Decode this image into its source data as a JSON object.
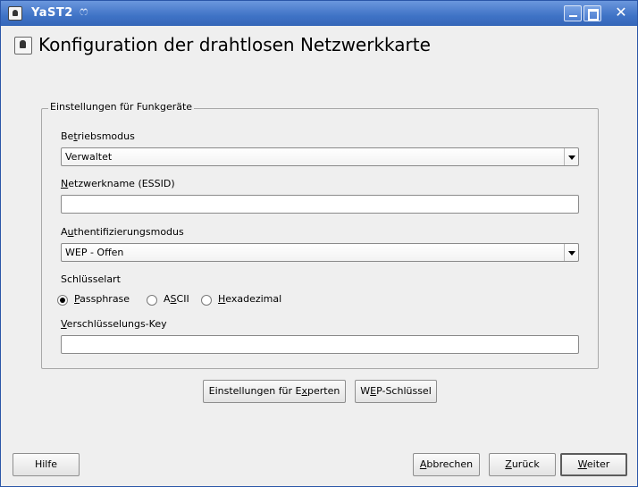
{
  "window": {
    "title": "YaST2",
    "swirl_glyph": "ෆ"
  },
  "page": {
    "title": "Konfiguration der drahtlosen Netzwerkkarte"
  },
  "group": {
    "title": "Einstellungen für Funkgeräte",
    "operating_mode": {
      "label_pre": "Be",
      "label_key": "t",
      "label_post": "riebsmodus",
      "value": "Verwaltet"
    },
    "network_name": {
      "label_pre": "",
      "label_key": "N",
      "label_post": "etzwerkname (ESSID)",
      "value": ""
    },
    "auth_mode": {
      "label_pre": "A",
      "label_key": "u",
      "label_post": "thentifizierungsmodus",
      "value": "WEP - Offen"
    },
    "key_type": {
      "label": "Schlüsselart",
      "options": [
        {
          "pre": "",
          "key": "P",
          "post": "assphrase",
          "checked": true
        },
        {
          "pre": "A",
          "key": "S",
          "post": "CII",
          "checked": false
        },
        {
          "pre": "",
          "key": "H",
          "post": "exadezimal",
          "checked": false
        }
      ]
    },
    "encryption_key": {
      "label_pre": "",
      "label_key": "V",
      "label_post": "erschlüsselungs-Key",
      "value": ""
    }
  },
  "buttons": {
    "expert": {
      "pre": "Einstellungen für E",
      "key": "x",
      "post": "perten"
    },
    "wep": {
      "pre": "W",
      "key": "E",
      "post": "P-Schlüssel"
    },
    "help": {
      "pre": "Hilfe",
      "key": "",
      "post": ""
    },
    "cancel": {
      "pre": "",
      "key": "A",
      "post": "bbrechen"
    },
    "back": {
      "pre": "",
      "key": "Z",
      "post": "urück"
    },
    "next": {
      "pre": "",
      "key": "W",
      "post": "eiter"
    }
  },
  "icons": {
    "window": "yast-app-icon",
    "header": "wireless-card-icon",
    "minimize": "minimize-icon",
    "maximize": "maximize-icon",
    "close": "close-icon"
  }
}
